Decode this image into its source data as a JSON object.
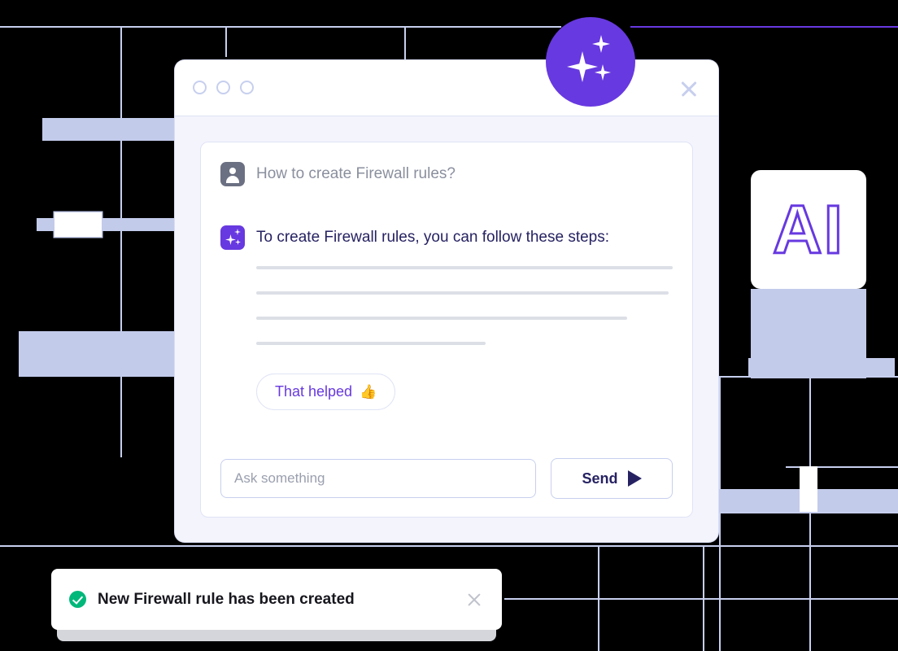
{
  "colors": {
    "brand_purple": "#6739e0",
    "periwinkle": "#c3cbeb",
    "grid_line": "#c7cfee",
    "window_body": "#f4f4fd",
    "ai_text_navy": "#262262",
    "user_text_gray": "#8a8f9e",
    "toast_success_green": "#00b87a",
    "background": "#000000"
  },
  "background": {
    "ai_badge_icon": "sparkles-icon",
    "ai_card_label": "AI"
  },
  "chat_window": {
    "titlebar": {
      "dots": [
        "dot-1",
        "dot-2",
        "dot-3"
      ],
      "close_icon": "close-icon"
    },
    "messages": [
      {
        "role": "user",
        "avatar_icon": "person-icon",
        "text": "How to create Firewall rules?"
      },
      {
        "role": "assistant",
        "avatar_icon": "sparkles-icon",
        "text": "To create Firewall rules, you can follow these steps:"
      }
    ],
    "skeleton_lines": [
      {
        "width": "100%"
      },
      {
        "width": "99%"
      },
      {
        "width": "89%"
      },
      {
        "width": "55%"
      }
    ],
    "feedback_button": {
      "label": "That helped",
      "emoji": "👍",
      "icon": "thumbs-up-icon"
    },
    "composer": {
      "input_value": "",
      "input_placeholder": "Ask something",
      "send_label": "Send",
      "send_icon": "send-arrow-icon"
    }
  },
  "toast": {
    "status_icon": "check-circle-icon",
    "message": "New Firewall rule has been created",
    "close_icon": "close-icon"
  }
}
